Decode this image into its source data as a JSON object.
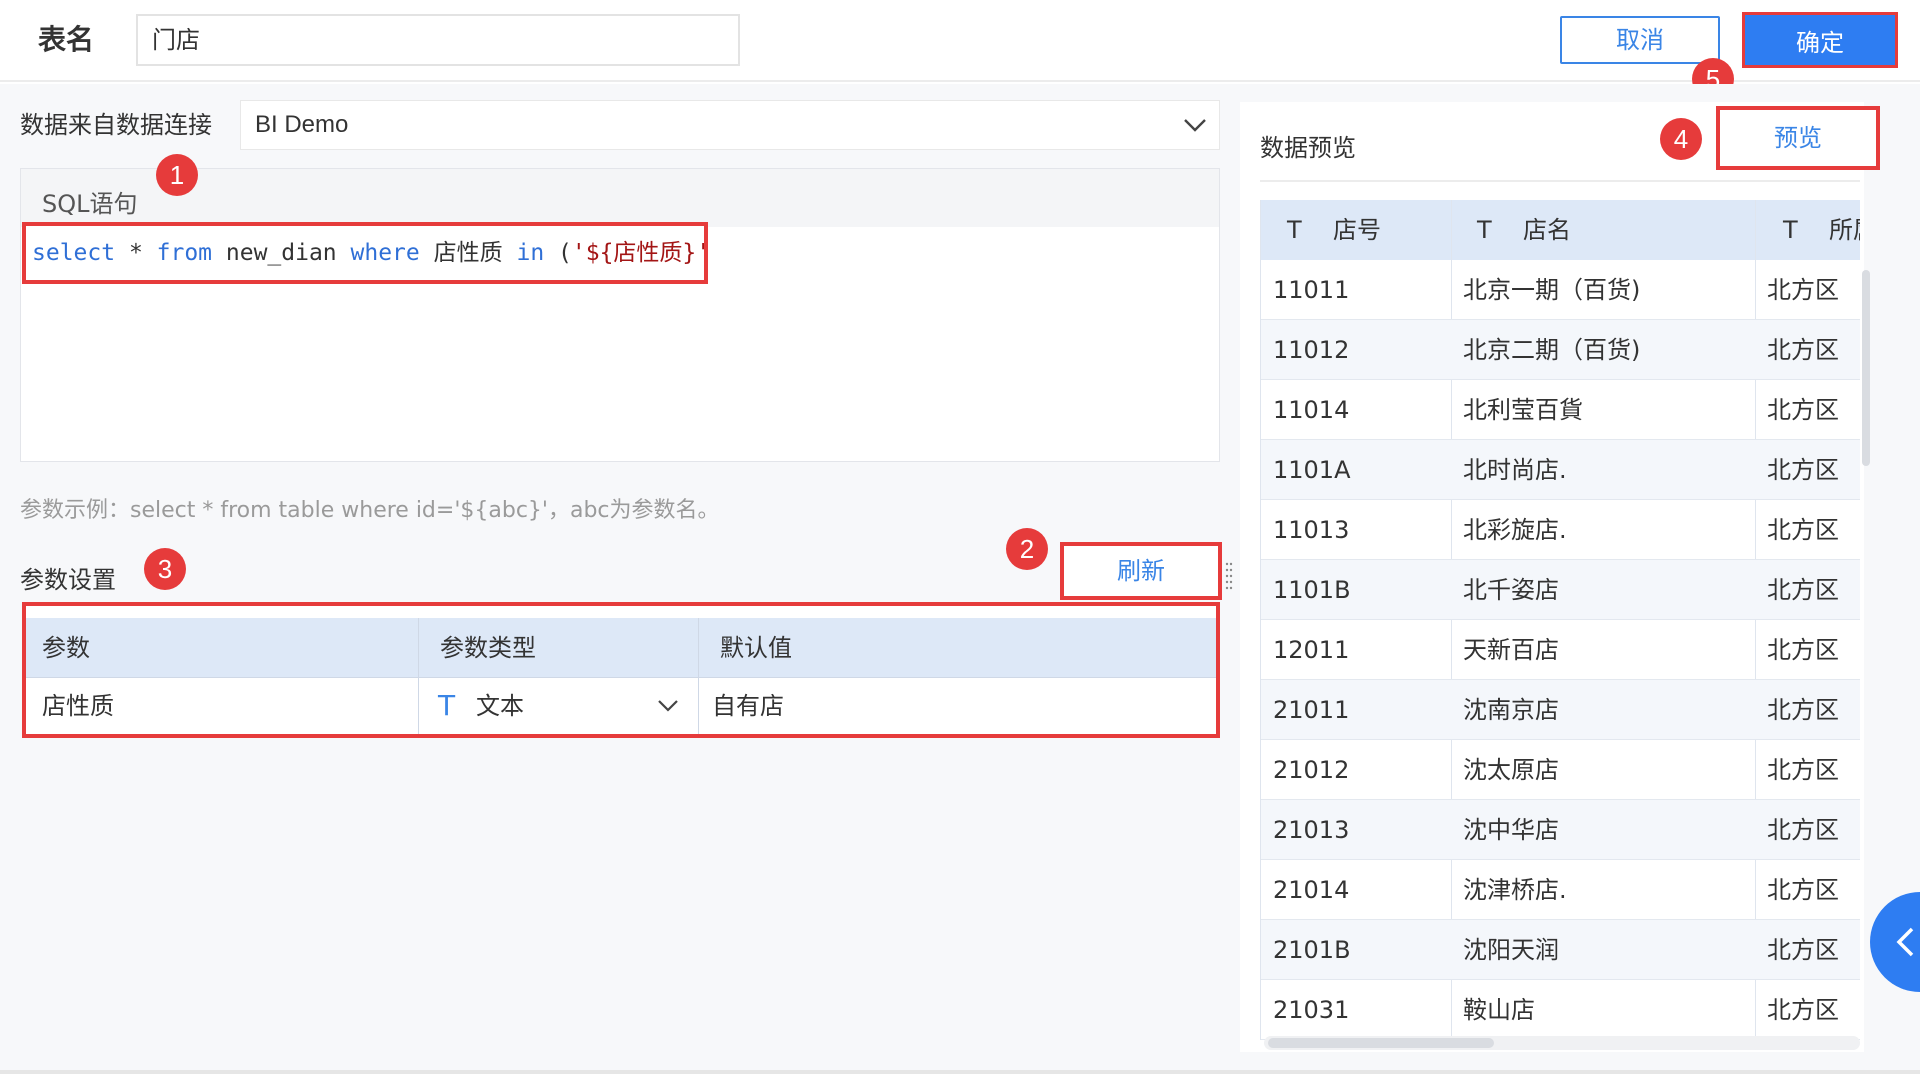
{
  "header": {
    "table_name_label": "表名",
    "table_name_value": "门店",
    "cancel_label": "取消",
    "confirm_label": "确定"
  },
  "data_source": {
    "label": "数据来自数据连接",
    "selected": "BI Demo"
  },
  "sql": {
    "title": "SQL语句",
    "tokens": {
      "t1": "select",
      "t2": " * ",
      "t3": "from",
      "t4": " new_dian ",
      "t5": "where",
      "t6": " 店性质 ",
      "t7": "in",
      "t8": " (",
      "t9": "'${店性质}'",
      "t10": ")"
    }
  },
  "hint": "参数示例：select * from table where id='${abc}'，abc为参数名。",
  "params": {
    "label": "参数设置",
    "refresh_label": "刷新",
    "columns": [
      "参数",
      "参数类型",
      "默认值"
    ],
    "rows": [
      {
        "name": "店性质",
        "type_icon": "T",
        "type": "文本",
        "default": "自有店"
      }
    ]
  },
  "preview": {
    "title": "数据预览",
    "button_label": "预览",
    "columns": [
      {
        "icon": "T",
        "label": "店号"
      },
      {
        "icon": "T",
        "label": "店名"
      },
      {
        "icon": "T",
        "label": "所属"
      }
    ],
    "rows": [
      [
        "11011",
        "北京一期（百货)",
        "北方区"
      ],
      [
        "11012",
        "北京二期（百货)",
        "北方区"
      ],
      [
        "11014",
        "北利莹百貨",
        "北方区"
      ],
      [
        "1101A",
        "北时尚店.",
        "北方区"
      ],
      [
        "11013",
        "北彩旋店.",
        "北方区"
      ],
      [
        "1101B",
        "北千姿店",
        "北方区"
      ],
      [
        "12011",
        "天新百店",
        "北方区"
      ],
      [
        "21011",
        "沈南京店",
        "北方区"
      ],
      [
        "21012",
        "沈太原店",
        "北方区"
      ],
      [
        "21013",
        "沈中华店",
        "北方区"
      ],
      [
        "21014",
        "沈津桥店.",
        "北方区"
      ],
      [
        "2101B",
        "沈阳天润",
        "北方区"
      ],
      [
        "21031",
        "鞍山店",
        "北方区"
      ]
    ]
  },
  "badges": [
    "1",
    "2",
    "3",
    "4",
    "5"
  ],
  "colors": {
    "primary": "#2e7df2",
    "highlight_border": "#e63b3b",
    "header_row": "#dde8f7"
  }
}
